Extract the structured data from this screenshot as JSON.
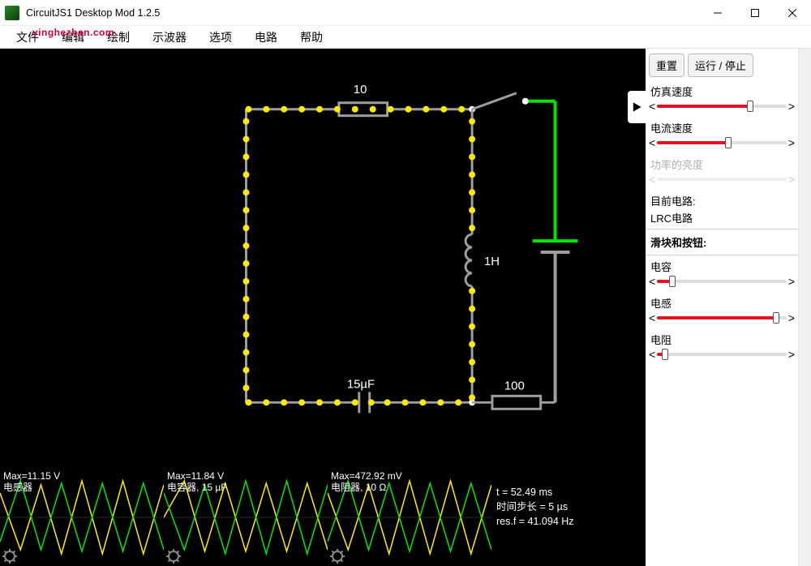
{
  "window": {
    "title": "CircuitJS1 Desktop Mod 1.2.5"
  },
  "menubar": [
    "文件",
    "编辑",
    "绘制",
    "示波器",
    "选项",
    "电路",
    "帮助"
  ],
  "watermark": "yinghezhan.com",
  "circuit_labels": {
    "r_top": "10",
    "inductor": "1H",
    "cap": "15µF",
    "r_bottom": "100"
  },
  "scopes": [
    {
      "line1": "Max=11.15 V",
      "line2": "电感器"
    },
    {
      "line1": "Max=11.84 V",
      "line2": "电容器, 15 µF"
    },
    {
      "line1": "Max=472.92 mV",
      "line2": "电阻器, 10 Ω"
    }
  ],
  "sim_info": {
    "t": "t = 52.49 ms",
    "step": "时间步长 = 5 µs",
    "resf": "res.f = 41.094 Hz"
  },
  "sidebar": {
    "reset": "重置",
    "runstop": "运行 / 停止",
    "sim_speed_label": "仿真速度",
    "current_speed_label": "电流速度",
    "power_brightness_label": "功率的亮度",
    "current_circuit_label": "目前电路:",
    "current_circuit_name": "LRC电路",
    "sliders_section": "滑块和按钮:",
    "cap_label": "电容",
    "ind_label": "电感",
    "res_label": "电阻"
  },
  "slider_positions": {
    "sim_speed": 0.72,
    "current_speed": 0.55,
    "power_brightness": 0.0,
    "cap": 0.12,
    "ind": 0.92,
    "res": 0.06
  }
}
